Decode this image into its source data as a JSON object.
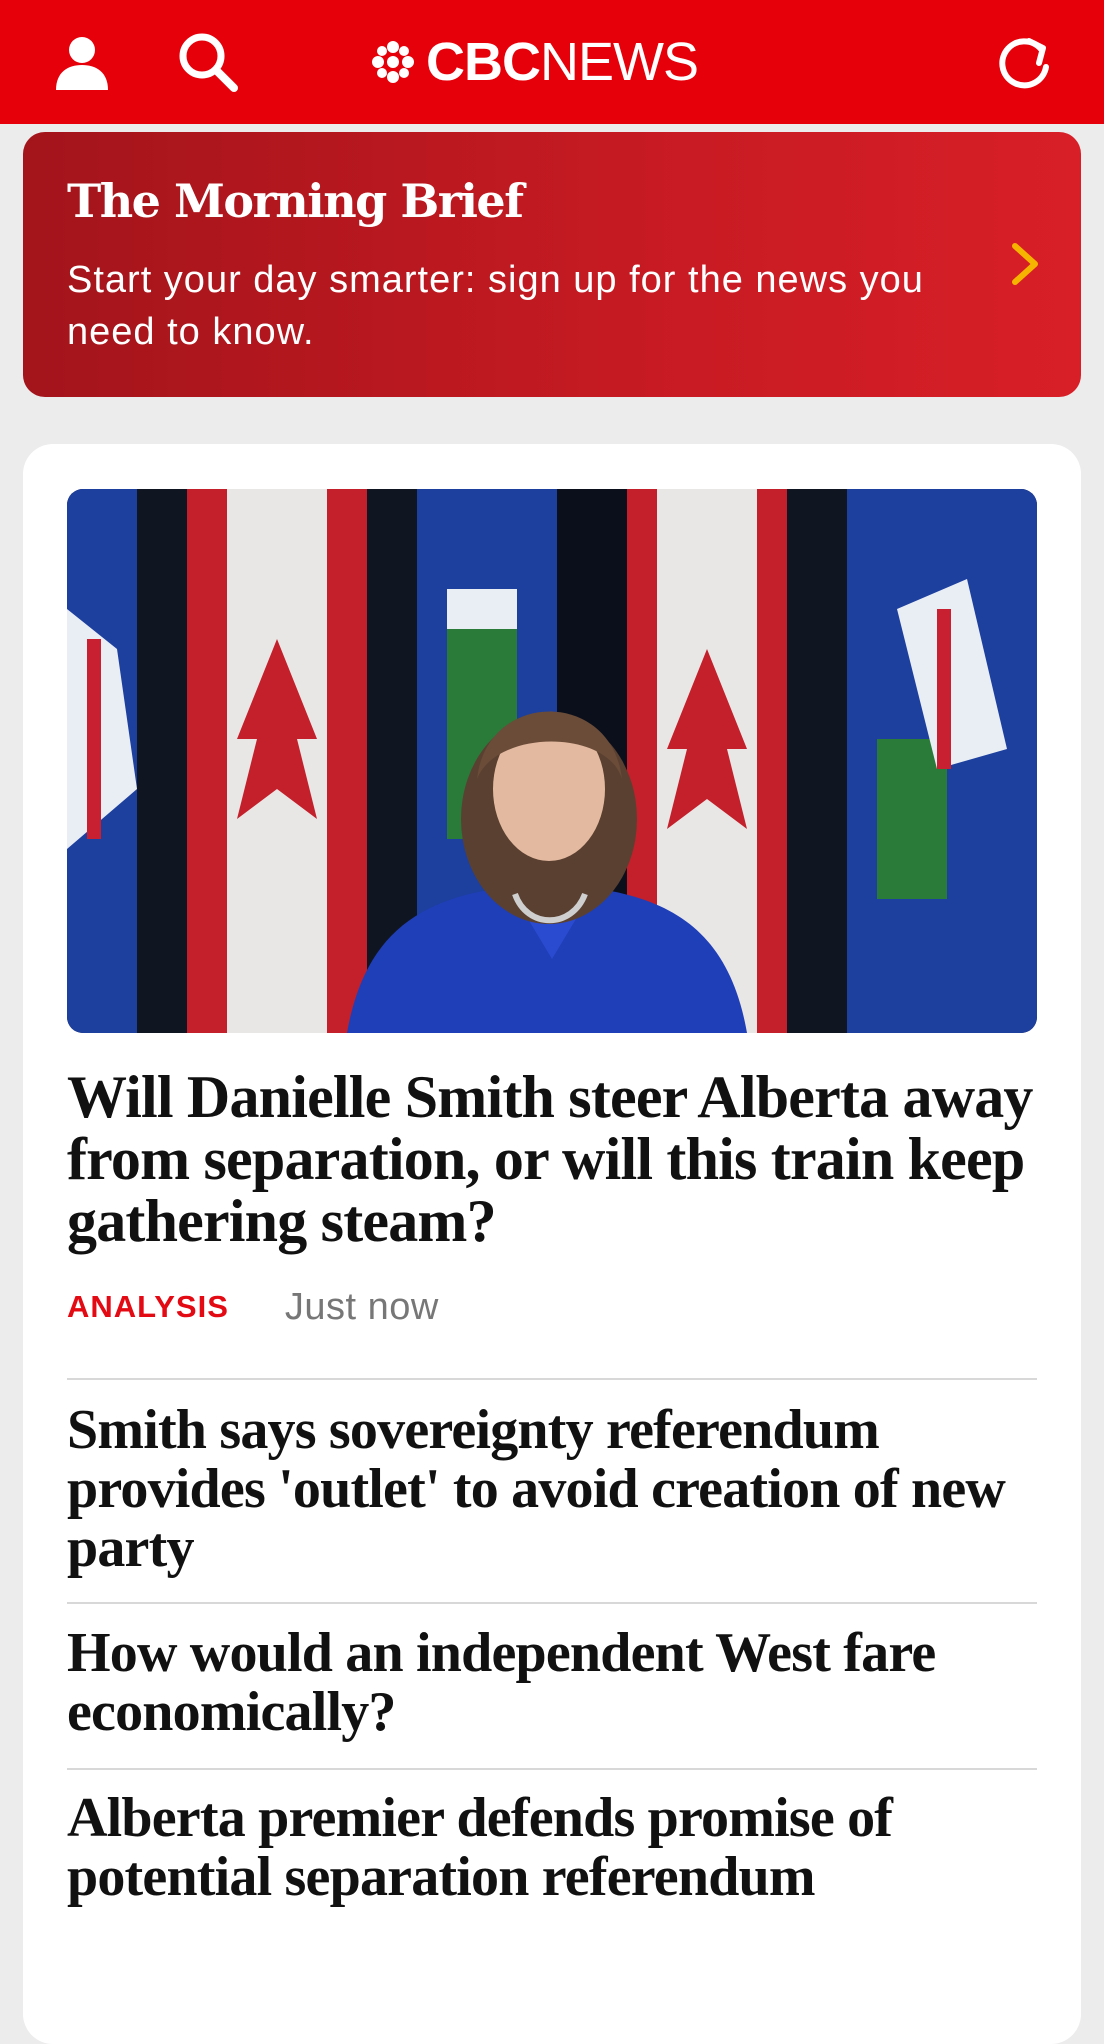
{
  "header": {
    "logo_bold": "CBC",
    "logo_light": "NEWS",
    "icons": [
      "user-icon",
      "search-icon",
      "refresh-icon"
    ],
    "brand_color": "#e6000a"
  },
  "promo": {
    "title": "The Morning Brief",
    "text": "Start your day smarter: sign up for the news you need to know.",
    "accent_color": "#f5b400"
  },
  "lead_story": {
    "headline": "Will Danielle Smith steer Alberta away from separation, or will this train keep gathering steam?",
    "tag": "ANALYSIS",
    "time": "Just now"
  },
  "related_stories": [
    {
      "headline": "Smith says sovereignty referendum provides 'outlet' to avoid creation of new party"
    },
    {
      "headline": "How would an independent West fare economically?"
    },
    {
      "headline": "Alberta premier defends promise of potential separation referendum"
    }
  ]
}
